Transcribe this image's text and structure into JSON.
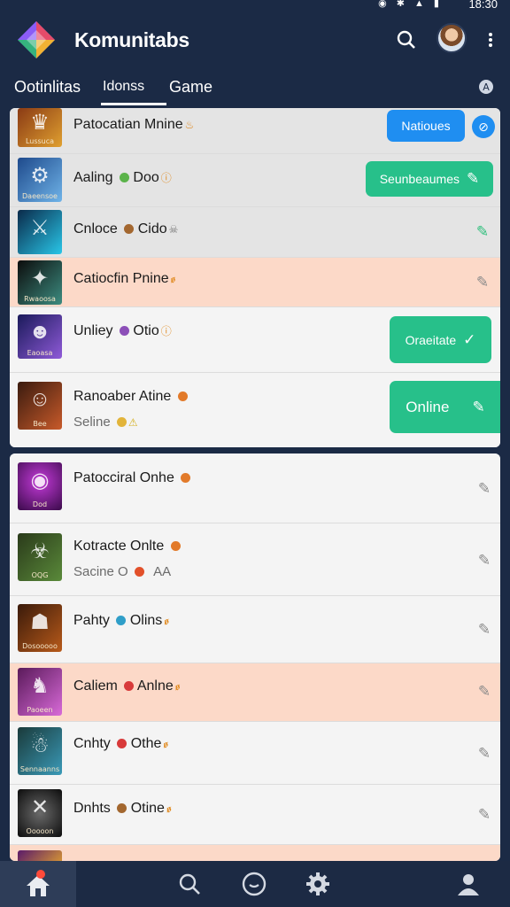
{
  "status": {
    "time": "18:30",
    "icons": "◉ ✱ ▲ ▮"
  },
  "header": {
    "title": "Komunitabs",
    "search_icon": "search-icon",
    "more_icon": "more-vertical-icon"
  },
  "tabs": [
    {
      "label": "Ootinlitas"
    },
    {
      "label": "Idonss"
    },
    {
      "label": "Game"
    }
  ],
  "tabs_extra": "A",
  "card1": [
    {
      "title": "Patocatian Mnine",
      "mini": "♨",
      "button": "Natioues",
      "button_color": "#1f8ef1",
      "caption": "Lussuca",
      "colors": [
        "#8a3a14",
        "#e0a030"
      ]
    },
    {
      "title": "Aaling",
      "badge_color": "#5bb34a",
      "title2": "Doo",
      "mini": "ⓘ",
      "button": "Seunbeaumes",
      "button_color": "#27c08a",
      "caption": "Daeensoe",
      "colors": [
        "#1e4a8c",
        "#6fb3e8"
      ]
    },
    {
      "title": "Cnloce",
      "badge_color": "#a3672f",
      "title2": "Cido",
      "mini": "☠",
      "caption": "",
      "colors": [
        "#0a2a4a",
        "#29c6e8"
      ]
    },
    {
      "title": "Catiocfin Pnine",
      "mini": "ꬾ",
      "caption": "Rwaoosa",
      "colors": [
        "#0c0c0c",
        "#3c8c80"
      ]
    },
    {
      "title": "Unliey",
      "badge_color": "#8c4fb8",
      "title2": "Otio",
      "mini": "ⓘ",
      "button": "Oraeitate",
      "button_color": "#27c08a",
      "caption": "Eaoasa",
      "colors": [
        "#1a1a5a",
        "#8f5ad8"
      ]
    },
    {
      "title": "Ranoaber Atine",
      "badge_color": "#e27a2a",
      "sub": "Seline",
      "sub_mini": "⚠",
      "button": "Online",
      "button_color": "#27c08a",
      "caption": "Bee",
      "colors": [
        "#3a1b0f",
        "#c85a2a"
      ]
    }
  ],
  "card2": [
    {
      "title": "Patocciral Onhe",
      "badge_color": "#e27a2a",
      "caption": "Dod",
      "colors": [
        "#3a0a4a",
        "#c33ad8"
      ]
    },
    {
      "title": "Kotracte Onlte",
      "badge_color": "#e27a2a",
      "sub": "Sacine",
      "sub2": "O",
      "sub_badge": "#e2502a",
      "sub3": "AA",
      "caption": "OQG",
      "colors": [
        "#2a3a1a",
        "#5a8a3a"
      ]
    },
    {
      "title": "Pahty",
      "badge_color": "#2f9ec8",
      "title2": "Olins",
      "mini": "ꬾ",
      "caption": "Dosooooo",
      "colors": [
        "#3a1a0a",
        "#b85a1a"
      ]
    },
    {
      "title": "Caliem",
      "badge_color": "#d83a3a",
      "title2": "Anlne",
      "mini": "ꬾ",
      "caption": "Paoeen",
      "colors": [
        "#5a1a5a",
        "#d86ad8"
      ]
    },
    {
      "title": "Cnhty",
      "badge_color": "#d83a3a",
      "title2": "Othe",
      "mini": "ꬾ",
      "caption": "Sennaanns",
      "colors": [
        "#1a3a3a",
        "#3a9ab8"
      ]
    },
    {
      "title": "Dnhts",
      "badge_color": "#a3672f",
      "title2": "Otine",
      "mini": "ꬾ",
      "caption": "Ooooon",
      "colors": [
        "#0c0c0c",
        "#6a6a6a"
      ]
    }
  ],
  "nav": [
    "home-icon",
    "search-icon",
    "chat-icon",
    "settings-icon",
    "profile-icon"
  ]
}
